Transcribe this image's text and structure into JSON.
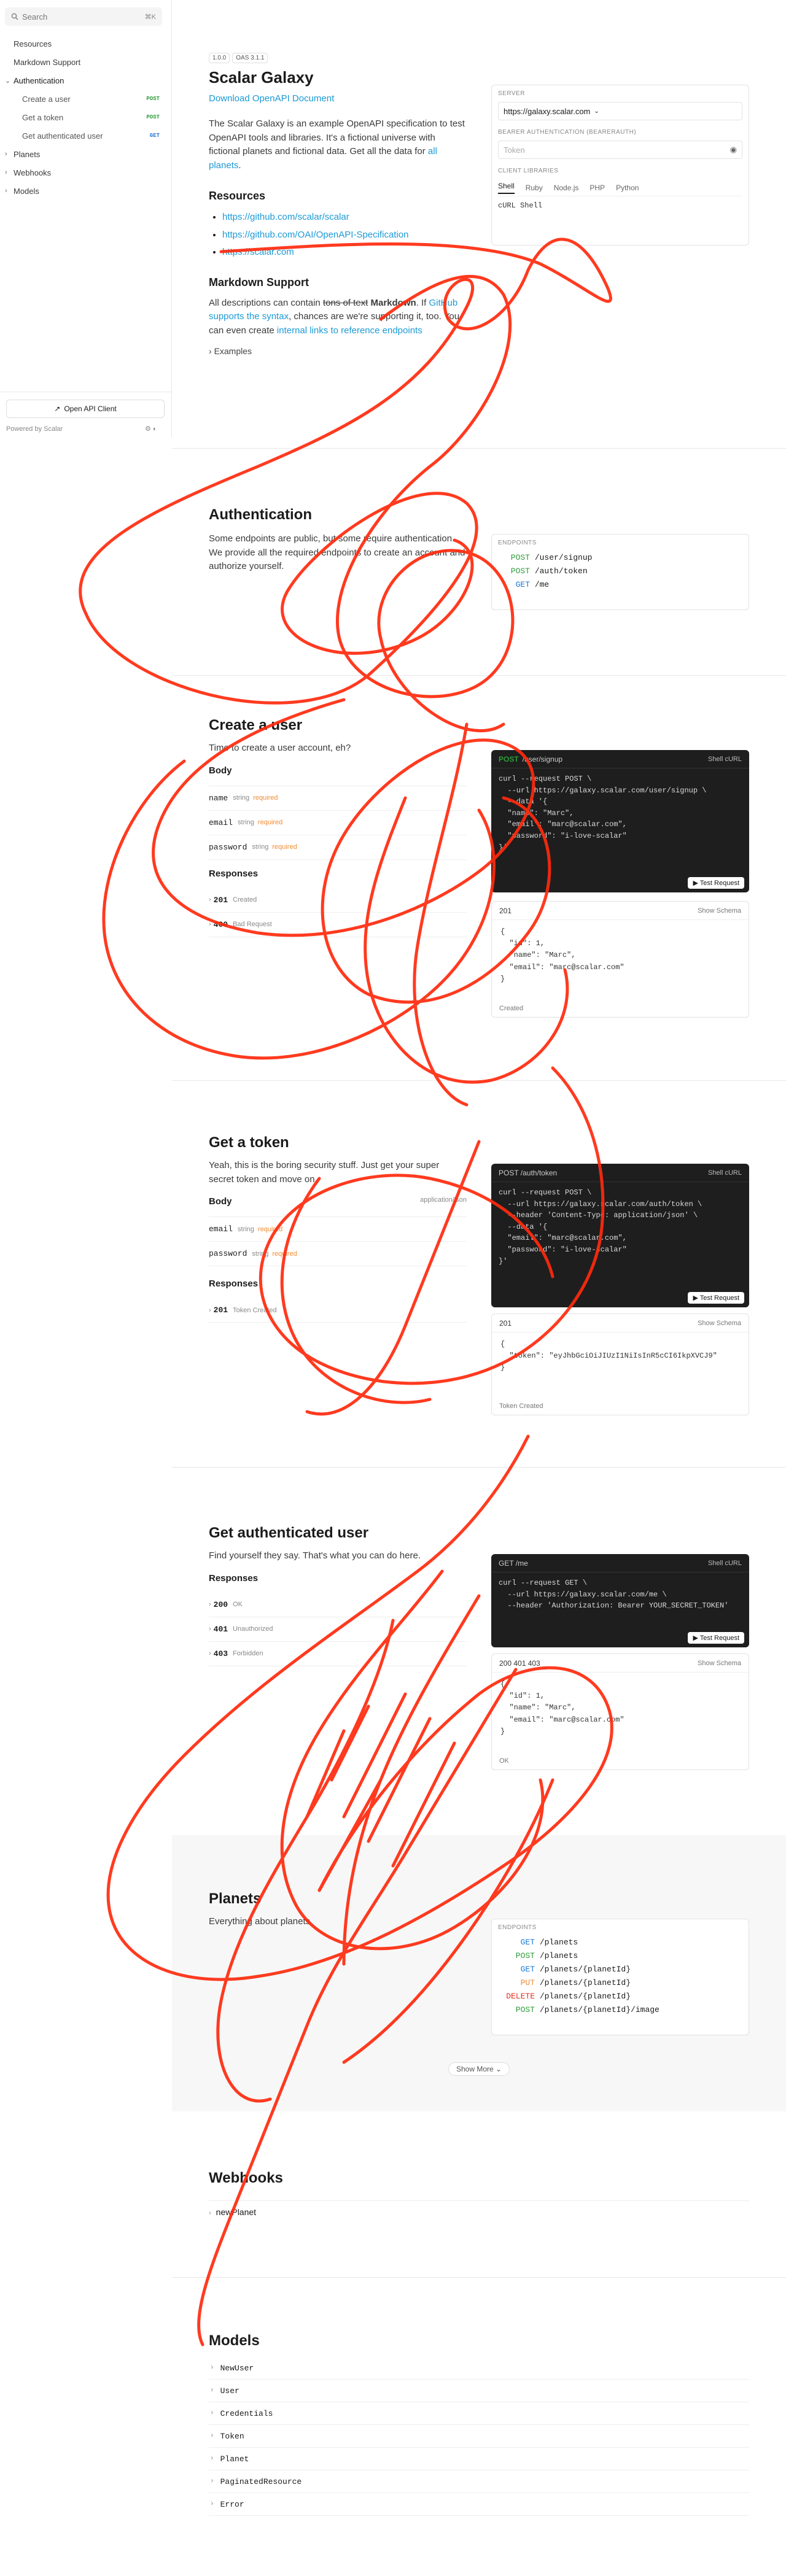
{
  "sidebar": {
    "search_placeholder": "Search",
    "search_kbd": "⌘K",
    "items": [
      {
        "label": "Resources"
      },
      {
        "label": "Markdown Support"
      },
      {
        "label": "Authentication"
      },
      {
        "label": "Create a user",
        "method": "POST"
      },
      {
        "label": "Get a token",
        "method": "POST"
      },
      {
        "label": "Get authenticated user",
        "method": "GET"
      },
      {
        "label": "Planets"
      },
      {
        "label": "Webhooks"
      },
      {
        "label": "Models"
      }
    ],
    "client_button": "Open API Client",
    "powered_by": "Powered by Scalar"
  },
  "intro": {
    "badge_version": "1.0.0",
    "badge_oas": "OAS 3.1.1",
    "title": "Scalar Galaxy",
    "download_link": "Download OpenAPI Document",
    "description_1": "The Scalar Galaxy is an example OpenAPI specification to test OpenAPI tools and libraries. It's a fictional universe with fictional planets and fictional data. Get all the data for ",
    "description_link": "all planets",
    "resources_heading": "Resources",
    "resources": [
      "https://github.com/scalar/scalar",
      "https://github.com/OAI/OpenAPI-Specification",
      "https://scalar.com"
    ],
    "markdown_heading": "Markdown Support",
    "markdown_text_1": "All descriptions can contain ",
    "markdown_strike": "tons of text",
    "markdown_bold": " Markdown",
    "markdown_text_2": ". If ",
    "markdown_link": "GitHub supports the syntax",
    "markdown_text_3": ", chances are we're supporting it, too. You can even create ",
    "markdown_link_2": "internal links to reference endpoints",
    "examples": "Examples"
  },
  "server_card": {
    "server_label": "SERVER",
    "server_value": "https://galaxy.scalar.com",
    "auth_label": "BEARER AUTHENTICATION (BEARERAUTH)",
    "token_placeholder": "Token",
    "client_label": "CLIENT LIBRARIES",
    "client_tabs": [
      "Shell",
      "Ruby",
      "Node.js",
      "PHP",
      "Python"
    ],
    "client_selected": "cURL Shell"
  },
  "authentication": {
    "title": "Authentication",
    "description": "Some endpoints are public, but some require authentication. We provide all the required endpoints to create an account and authorize yourself.",
    "endpoints_label": "ENDPOINTS",
    "endpoints": [
      {
        "method": "POST",
        "path": "/user/signup"
      },
      {
        "method": "POST",
        "path": "/auth/token"
      },
      {
        "method": "GET",
        "path": "/me"
      }
    ]
  },
  "create_user": {
    "title": "Create a user",
    "description": "Time to create a user account, eh?",
    "body_label": "Body",
    "fields": [
      {
        "name": "name",
        "type": "string",
        "req": "required"
      },
      {
        "name": "email",
        "type": "string",
        "req": "required"
      },
      {
        "name": "password",
        "type": "string",
        "req": "required"
      }
    ],
    "responses_label": "Responses",
    "responses": [
      {
        "code": "201",
        "desc": "Created"
      },
      {
        "code": "400",
        "desc": "Bad Request"
      }
    ],
    "code_head": "/user/signup",
    "code_lang": "Shell cURL",
    "code": "curl --request POST \\\n  --url https://galaxy.scalar.com/user/signup \\\n  --data '{\n  \"name\": \"Marc\",\n  \"email\": \"marc@scalar.com\",\n  \"password\": \"i-love-scalar\"\n}'",
    "test_button": "Test Request",
    "resp_code": "201",
    "show_schema": "Show Schema",
    "resp_body": "{\n  \"id\": 1,\n  \"name\": \"Marc\",\n  \"email\": \"marc@scalar.com\"\n}",
    "resp_foot": "Created"
  },
  "get_token": {
    "title": "Get a token",
    "description": "Yeah, this is the boring security stuff. Just get your super secret token and move on.",
    "body_label": "Body",
    "body_type": "application/json",
    "fields": [
      {
        "name": "email",
        "type": "string",
        "req": "required"
      },
      {
        "name": "password",
        "type": "string",
        "req": "required"
      }
    ],
    "responses_label": "Responses",
    "responses": [
      {
        "code": "201",
        "desc": "Token Created"
      }
    ],
    "code_head": "POST /auth/token",
    "code_lang": "Shell cURL",
    "code": "curl --request POST \\\n  --url https://galaxy.scalar.com/auth/token \\\n  --header 'Content-Type: application/json' \\\n  --data '{\n  \"email\": \"marc@scalar.com\",\n  \"password\": \"i-love-scalar\"\n}'",
    "test_button": "Test Request",
    "resp_code": "201",
    "show_schema": "Show Schema",
    "resp_body": "{\n  \"token\": \"eyJhbGciOiJIUzI1NiIsInR5cCI6IkpXVCJ9\"\n}",
    "resp_foot": "Token Created"
  },
  "auth_user": {
    "title": "Get authenticated user",
    "description": "Find yourself they say. That's what you can do here.",
    "responses_label": "Responses",
    "responses": [
      {
        "code": "200",
        "desc": "OK"
      },
      {
        "code": "401",
        "desc": "Unauthorized"
      },
      {
        "code": "403",
        "desc": "Forbidden"
      }
    ],
    "code_head": "GET /me",
    "code_lang": "Shell cURL",
    "code": "curl --request GET \\\n  --url https://galaxy.scalar.com/me \\\n  --header 'Authorization: Bearer YOUR_SECRET_TOKEN'",
    "test_button": "Test Request",
    "resp_code": "200 401 403",
    "show_schema": "Show Schema",
    "resp_body": "{\n  \"id\": 1,\n  \"name\": \"Marc\",\n  \"email\": \"marc@scalar.com\"\n}",
    "resp_foot": "OK"
  },
  "planets": {
    "title": "Planets",
    "description": "Everything about planets",
    "endpoints_label": "ENDPOINTS",
    "endpoints": [
      {
        "method": "GET",
        "path": "/planets"
      },
      {
        "method": "POST",
        "path": "/planets"
      },
      {
        "method": "GET",
        "path": "/planets/{planetId}"
      },
      {
        "method": "PUT",
        "path": "/planets/{planetId}"
      },
      {
        "method": "DELETE",
        "path": "/planets/{planetId}"
      },
      {
        "method": "POST",
        "path": "/planets/{planetId}/image"
      }
    ],
    "show_more": "Show More"
  },
  "webhooks": {
    "title": "Webhooks",
    "items": [
      "newPlanet"
    ]
  },
  "models": {
    "title": "Models",
    "items": [
      "NewUser",
      "User",
      "Credentials",
      "Token",
      "Planet",
      "PaginatedResource",
      "Error"
    ]
  },
  "colors": {
    "accent": "#1c9ad6",
    "scribble": "#ff2a0d",
    "post": "#2f9c3a",
    "get": "#1c78d6"
  }
}
